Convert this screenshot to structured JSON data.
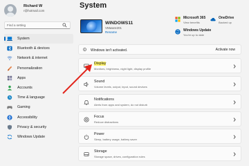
{
  "user": {
    "name": "Richard W",
    "email": "r@hotmail.com"
  },
  "search": {
    "placeholder": "Find a setting"
  },
  "sidebar": {
    "items": [
      {
        "label": "System",
        "active": true,
        "icon": "laptop-icon",
        "color": "#0078d4"
      },
      {
        "label": "Bluetooth & devices",
        "icon": "bluetooth-icon",
        "color": "#0067c0"
      },
      {
        "label": "Network & internet",
        "icon": "wifi-icon",
        "color": "#5b8fd1"
      },
      {
        "label": "Personalization",
        "icon": "brush-icon",
        "color": "#e4834a"
      },
      {
        "label": "Apps",
        "icon": "apps-icon",
        "color": "#6e6e8e"
      },
      {
        "label": "Accounts",
        "icon": "person-icon",
        "color": "#2ea04f"
      },
      {
        "label": "Time & language",
        "icon": "clock-globe-icon",
        "color": "#1e88c7"
      },
      {
        "label": "Gaming",
        "icon": "gamepad-icon",
        "color": "#7a7a7a"
      },
      {
        "label": "Accessibility",
        "icon": "accessibility-icon",
        "color": "#1f6fd1"
      },
      {
        "label": "Privacy & security",
        "icon": "shield-icon",
        "color": "#6b7b8c"
      },
      {
        "label": "Windows Update",
        "icon": "sync-icon",
        "color": "#1479d1"
      }
    ]
  },
  "main": {
    "title": "System",
    "device": {
      "name": "WINDOWS11",
      "model": "VMware201",
      "rename": "Rename"
    },
    "quick": {
      "m365": {
        "title": "Microsoft 365",
        "subtitle": "View benefits"
      },
      "onedrive": {
        "title": "OneDrive",
        "subtitle": "Backed up"
      },
      "update": {
        "title": "Windows Update",
        "subtitle": "You're up to date"
      }
    },
    "activation": {
      "text": "Windows isn't activated.",
      "button": "Activate now"
    },
    "cards": [
      {
        "title": "Display",
        "subtitle": "Monitors, brightness, night light, display profile",
        "icon": "monitor-icon"
      },
      {
        "title": "Sound",
        "subtitle": "Volume levels, output, input, sound devices",
        "icon": "speaker-icon"
      },
      {
        "title": "Notifications",
        "subtitle": "Alerts from apps and system, do not disturb",
        "icon": "bell-icon"
      },
      {
        "title": "Focus",
        "subtitle": "Reduce distractions",
        "icon": "focus-icon"
      },
      {
        "title": "Power",
        "subtitle": "Sleep, battery usage, battery saver",
        "icon": "power-icon"
      },
      {
        "title": "Storage",
        "subtitle": "Storage space, drives, configuration rules",
        "icon": "storage-icon"
      }
    ]
  },
  "colors": {
    "accent": "#0067c0",
    "highlight": "#fff36b",
    "annotation_arrow": "#e2231a"
  }
}
